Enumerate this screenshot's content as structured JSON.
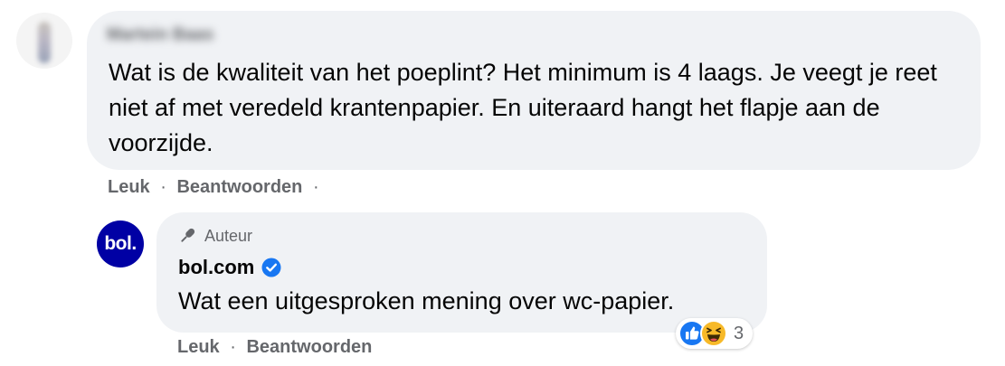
{
  "comment": {
    "author_name": "Martein Baas",
    "text": "Wat is de kwaliteit van het poeplint? Het minimum is 4 laags. Je veegt je reet niet af met veredeld krantenpapier. En uiteraard hangt het flapje aan de voorzijde.",
    "actions": {
      "like": "Leuk",
      "separator": "·",
      "reply": "Beantwoorden"
    }
  },
  "reply": {
    "avatar_text": "bol.",
    "badge_label": "Auteur",
    "badge_icon": "microphone-icon",
    "author_name": "bol.com",
    "verified_icon": "verified-badge-icon",
    "text": "Wat een uitgesproken mening over wc-papier.",
    "reactions": {
      "icons": [
        "like-icon",
        "haha-icon"
      ],
      "count": "3"
    },
    "actions": {
      "like": "Leuk",
      "separator": "·",
      "reply": "Beantwoorden"
    }
  },
  "colors": {
    "bubble_bg": "#f0f2f5",
    "muted_text": "#65676b",
    "bol_blue": "#0000a4",
    "verified_blue": "#1877f2"
  }
}
